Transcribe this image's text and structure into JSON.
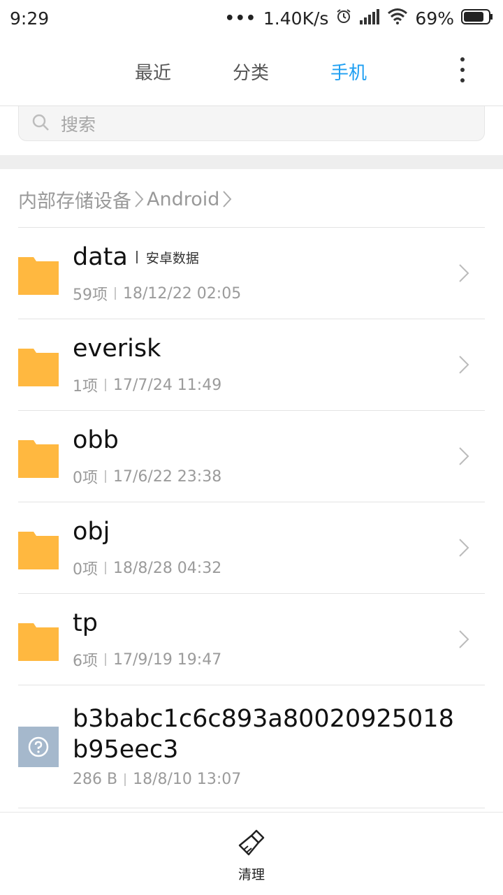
{
  "status": {
    "time": "9:29",
    "dots": "•••",
    "speed": "1.40K/s",
    "battery": "69%"
  },
  "tabs": [
    {
      "label": "最近",
      "active": false
    },
    {
      "label": "分类",
      "active": false
    },
    {
      "label": "手机",
      "active": true
    }
  ],
  "search": {
    "placeholder": "搜索"
  },
  "breadcrumb": [
    "内部存储设备",
    "Android"
  ],
  "files": [
    {
      "name": "data",
      "tag": "安卓数据",
      "count": "59项",
      "date": "18/12/22 02:05",
      "type": "folder"
    },
    {
      "name": "everisk",
      "tag": "",
      "count": "1项",
      "date": "17/7/24 11:49",
      "type": "folder"
    },
    {
      "name": "obb",
      "tag": "",
      "count": "0项",
      "date": "17/6/22 23:38",
      "type": "folder"
    },
    {
      "name": "obj",
      "tag": "",
      "count": "0项",
      "date": "18/8/28 04:32",
      "type": "folder"
    },
    {
      "name": "tp",
      "tag": "",
      "count": "6项",
      "date": "17/9/19 19:47",
      "type": "folder"
    },
    {
      "name": "b3babc1c6c893a80020925018b95eec3",
      "tag": "",
      "count": "286 B",
      "date": "18/8/10 13:07",
      "type": "unknown"
    }
  ],
  "bottom": {
    "clean_label": "清理"
  },
  "colors": {
    "accent": "#1e9ff2",
    "folder": "#ffb840",
    "unknown_file": "#a5b8cc"
  },
  "icons": [
    "search-icon",
    "folder-icon",
    "chevron-right-icon",
    "unknown-file-icon",
    "broom-icon",
    "more-vert-icon",
    "alarm-icon",
    "signal-icon",
    "wifi-icon",
    "battery-icon"
  ]
}
